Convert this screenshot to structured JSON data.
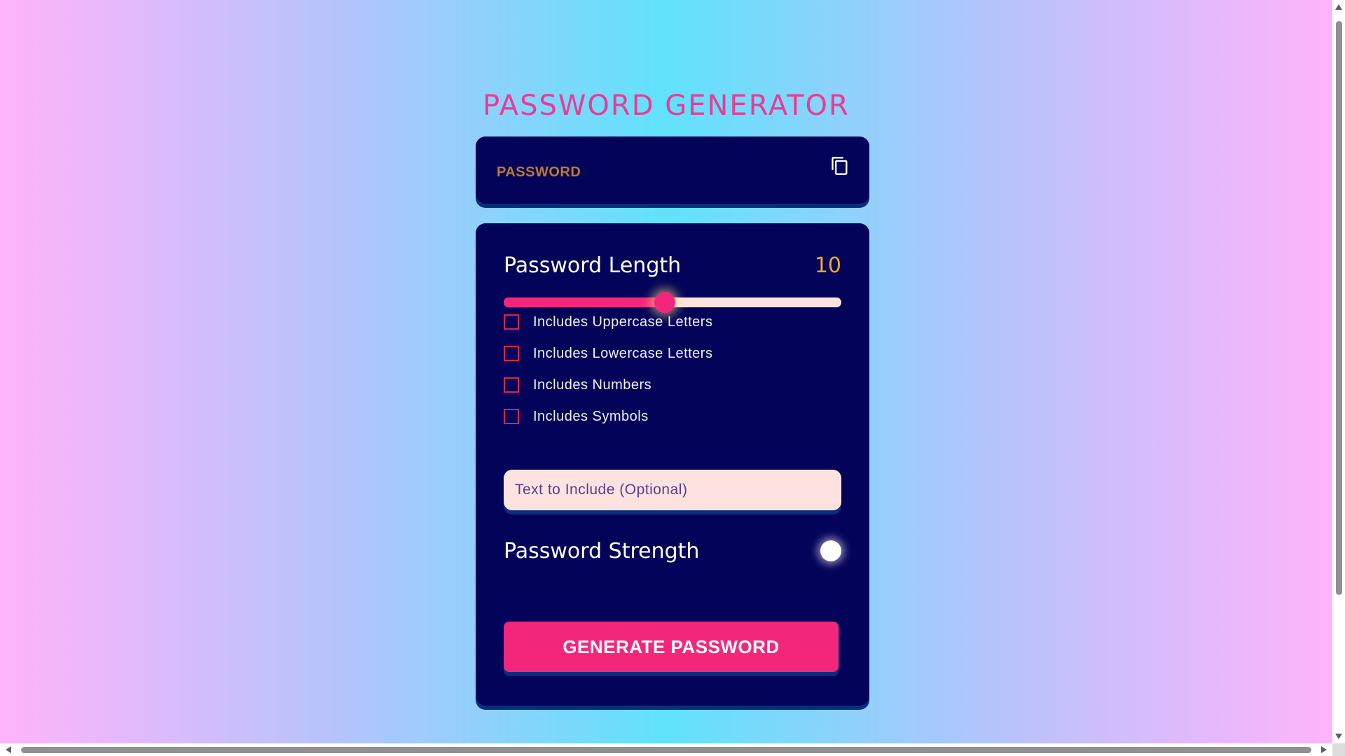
{
  "app": {
    "title": "PASSWORD GENERATOR"
  },
  "password": {
    "display": "PASSWORD",
    "copy_icon": "copy-icon"
  },
  "length": {
    "label": "Password Length",
    "value": "10",
    "slider_fraction": 0.477
  },
  "options": [
    {
      "label": "Includes Uppercase Letters",
      "checked": false
    },
    {
      "label": "Includes Lowercase Letters",
      "checked": false
    },
    {
      "label": "Includes Numbers",
      "checked": false
    },
    {
      "label": "Includes Symbols",
      "checked": false
    }
  ],
  "include_text": {
    "placeholder": "Text to Include (Optional)",
    "value": ""
  },
  "strength": {
    "label": "Password Strength",
    "indicator_color": "#ffffff"
  },
  "generate_button": {
    "label": "GENERATE PASSWORD"
  },
  "colors": {
    "accent": "#f2277c",
    "panel": "#03035a",
    "title": "#e93c92",
    "length_value": "#f5a623",
    "password_text": "#c07a2c",
    "input_bg": "#fde2e0"
  }
}
